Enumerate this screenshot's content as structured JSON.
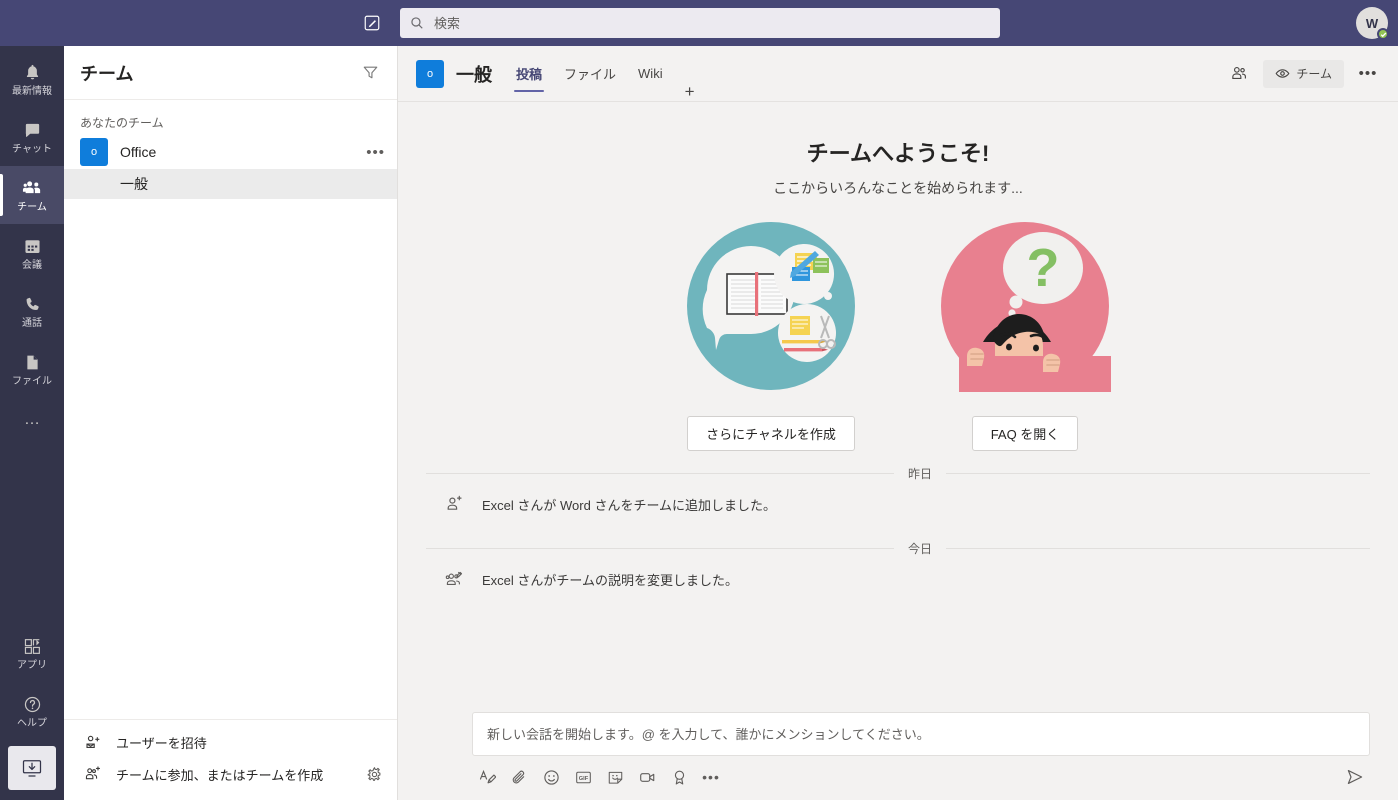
{
  "titlebar": {
    "compose_icon": "compose-icon",
    "search": {
      "placeholder": "検索",
      "value": "",
      "icon": "search-icon"
    },
    "avatar": {
      "initials": "W",
      "presence": "available"
    }
  },
  "rail": {
    "items": [
      {
        "label": "最新情報",
        "icon": "bell-icon",
        "active": false
      },
      {
        "label": "チャット",
        "icon": "chat-icon",
        "active": false
      },
      {
        "label": "チーム",
        "icon": "teams-icon",
        "active": true
      },
      {
        "label": "会議",
        "icon": "calendar-icon",
        "active": false
      },
      {
        "label": "通話",
        "icon": "phone-icon",
        "active": false
      },
      {
        "label": "ファイル",
        "icon": "file-icon",
        "active": false
      }
    ],
    "more_label": "…",
    "bottom_items": [
      {
        "label": "アプリ",
        "icon": "apps-icon"
      },
      {
        "label": "ヘルプ",
        "icon": "help-icon"
      }
    ],
    "download_icon": "download-desktop-app-icon"
  },
  "sidebar": {
    "title": "チーム",
    "filter_icon": "filter-icon",
    "group_label": "あなたのチーム",
    "teams": [
      {
        "name": "Office",
        "avatar_letter": "o",
        "more_label": "•••",
        "channels": [
          {
            "name": "一般",
            "selected": true
          }
        ]
      }
    ],
    "footer": [
      {
        "label": "ユーザーを招待",
        "icon": "invite-user-icon"
      },
      {
        "label": "チームに参加、またはチームを作成",
        "icon": "join-create-team-icon"
      }
    ],
    "settings_icon": "gear-icon"
  },
  "channel_header": {
    "team_avatar_letter": "o",
    "channel_name": "一般",
    "tabs": [
      {
        "label": "投稿",
        "active": true
      },
      {
        "label": "ファイル",
        "active": false
      },
      {
        "label": "Wiki",
        "active": false
      }
    ],
    "add_tab_label": "+",
    "people_icon": "people-icon",
    "team_pill": {
      "label": "チーム",
      "icon": "eye-icon"
    },
    "more_label": "•••"
  },
  "conversation": {
    "welcome": {
      "heading": "チームへようこそ!",
      "subheading": "ここからいろんなことを始められます...",
      "cards": [
        {
          "art": "channels-illustration",
          "button": "さらにチャネルを作成",
          "accent": "#6fb5bd"
        },
        {
          "art": "faq-illustration",
          "button": "FAQ を開く",
          "accent": "#e8808f"
        }
      ]
    },
    "date_dividers": [
      {
        "label": "昨日"
      },
      {
        "label": "今日"
      }
    ],
    "system_messages": [
      {
        "icon": "add-person-icon",
        "text": "Excel さんが Word さんをチームに追加しました。"
      },
      {
        "icon": "team-edit-icon",
        "text": "Excel さんがチームの説明を変更しました。"
      }
    ]
  },
  "compose": {
    "placeholder": "新しい会話を開始します。@ を入力して、誰かにメンションしてください。",
    "value": "",
    "tools": [
      {
        "icon": "format-text-icon"
      },
      {
        "icon": "attach-icon"
      },
      {
        "icon": "emoji-icon"
      },
      {
        "icon": "giphy-icon"
      },
      {
        "icon": "sticker-icon"
      },
      {
        "icon": "meet-now-icon"
      },
      {
        "icon": "praise-icon"
      },
      {
        "icon": "more-options-icon"
      }
    ],
    "more_label": "•••",
    "send_icon": "send-icon"
  },
  "colors": {
    "titlebar": "#464775",
    "rail": "#33344a",
    "accent": "#6264a7",
    "team_avatar": "#0f7ddb",
    "presence_available": "#92c353",
    "card1_accent": "#6fb5bd",
    "card2_accent": "#e8808f"
  }
}
